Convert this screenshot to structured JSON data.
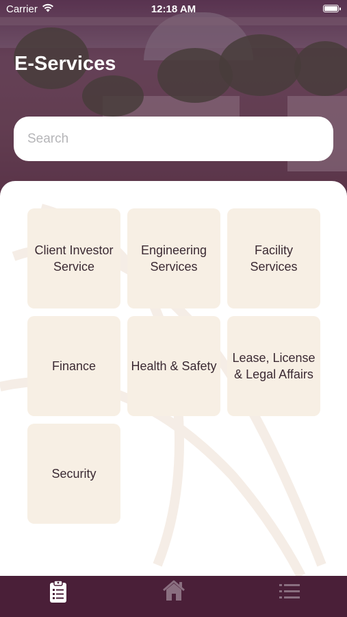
{
  "status_bar": {
    "carrier": "Carrier",
    "time": "12:18 AM"
  },
  "header": {
    "title": "E-Services"
  },
  "search": {
    "placeholder": "Search",
    "value": ""
  },
  "services": [
    {
      "label": "Client Investor Service"
    },
    {
      "label": "Engineering Services"
    },
    {
      "label": "Facility Services"
    },
    {
      "label": "Finance"
    },
    {
      "label": "Health & Safety"
    },
    {
      "label": "Lease, License & Legal Affairs"
    },
    {
      "label": "Security"
    }
  ],
  "tab_bar": {
    "tabs": [
      {
        "icon": "clipboard-icon",
        "active": true
      },
      {
        "icon": "home-icon",
        "active": false
      },
      {
        "icon": "list-icon",
        "active": false
      }
    ]
  },
  "colors": {
    "brand": "#4a1f38",
    "tile_background": "#f7efe4",
    "tile_text": "#3b2a33",
    "inactive_icon": "#8a6f80"
  }
}
